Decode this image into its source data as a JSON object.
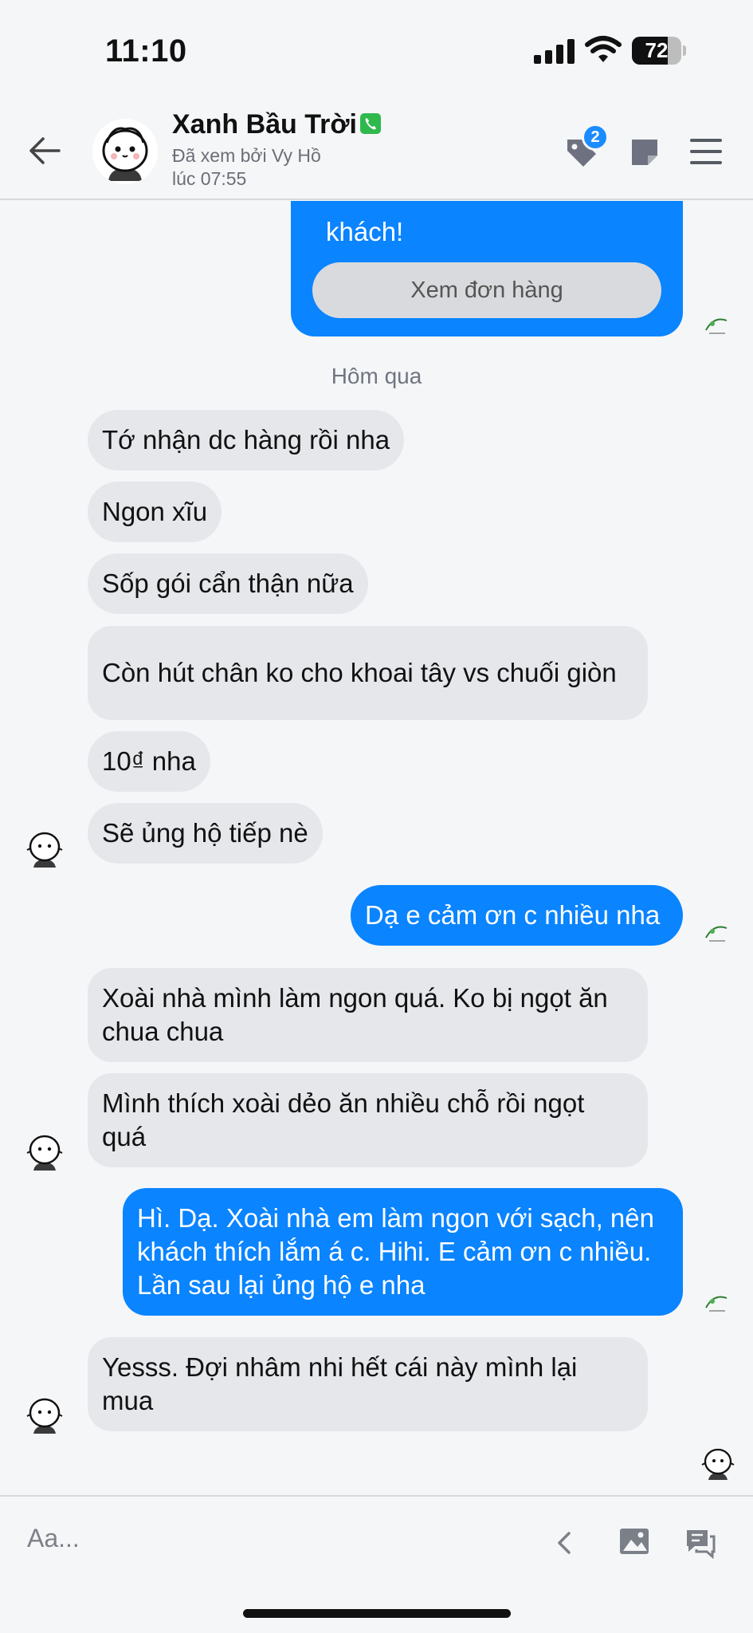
{
  "status_bar": {
    "time": "11:10",
    "battery": "72",
    "battery_level": 0.72
  },
  "header": {
    "contact_name": "Xanh Bầu Trời",
    "seen_line1": "Đã xem bởi Vy Hồ",
    "seen_line2": "lúc 07:55",
    "tag_badge_count": "2",
    "icons": [
      "back-arrow-icon",
      "phone-icon",
      "tag-icon",
      "note-icon",
      "menu-icon"
    ]
  },
  "conversation": {
    "top_partial_message": "khách!",
    "order_button": "Xem đơn hàng",
    "date_separator": "Hôm qua",
    "messages": [
      {
        "from": "them",
        "text": "Tớ nhận dc hàng rồi nha"
      },
      {
        "from": "them",
        "text": "Ngon xĩu"
      },
      {
        "from": "them",
        "text": "Sốp gói cẩn thận nữa"
      },
      {
        "from": "them",
        "text": "Còn hút chân ko cho khoai tây vs chuối giòn"
      },
      {
        "from": "them",
        "text": "10₫ nha"
      },
      {
        "from": "them",
        "text": "Sẽ ủng hộ tiếp nè"
      },
      {
        "from": "me",
        "text": "Dạ e cảm ơn c nhiều nha"
      },
      {
        "from": "them",
        "text": "Xoài nhà mình làm ngon quá. Ko bị ngọt ăn chua chua"
      },
      {
        "from": "them",
        "text": "Mình thích xoài dẻo ăn nhiều chỗ rồi ngọt quá"
      },
      {
        "from": "me",
        "text": "Hì. Dạ. Xoài nhà em làm ngon với sạch, nên khách thích lắm á c. Hihi. E cảm ơn c nhiều. Lần sau lại ủng hộ e nha"
      },
      {
        "from": "them",
        "text": "Yesss. Đợi nhâm nhi hết cái này mình lại mua"
      }
    ]
  },
  "composer": {
    "placeholder": "Aa...",
    "icons": [
      "chevron-left-icon",
      "image-icon",
      "quick-reply-icon"
    ]
  }
}
